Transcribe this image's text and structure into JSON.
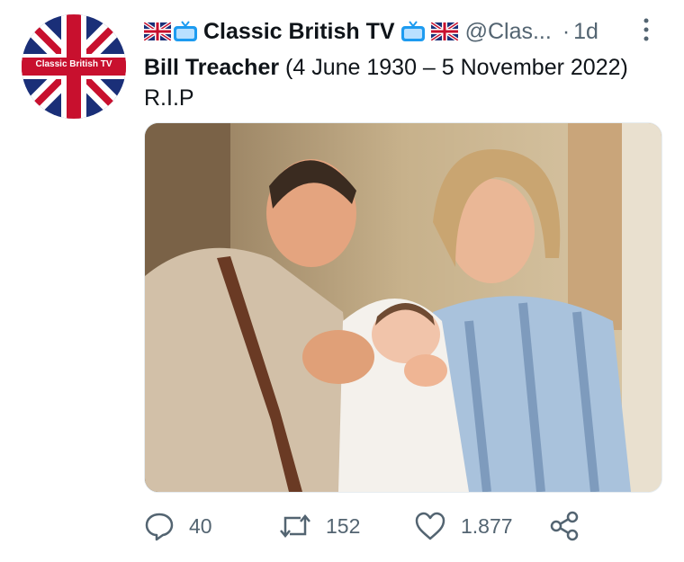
{
  "tweet": {
    "avatar_label": "Classic British TV",
    "display_name": "Classic British TV",
    "handle": "@Clas...",
    "separator": "·",
    "time": "1d",
    "headline_bold": "Bill Treacher",
    "headline_rest": " (4 June 1930 – 5 November 2022)",
    "body": "R.I.P",
    "image_alt": "Photo of a smiling man and woman holding a newborn baby"
  },
  "actions": {
    "replies": "40",
    "retweets": "152",
    "likes": "1.877"
  },
  "colors": {
    "text": "#0f1419",
    "muted": "#536471",
    "flag_blue": "#1a2f78",
    "flag_red": "#c8102e",
    "tv_blue": "#1d9bf0"
  },
  "icons": [
    "uk-flag-icon",
    "tv-icon",
    "more-icon",
    "reply-icon",
    "retweet-icon",
    "like-icon",
    "share-icon"
  ]
}
